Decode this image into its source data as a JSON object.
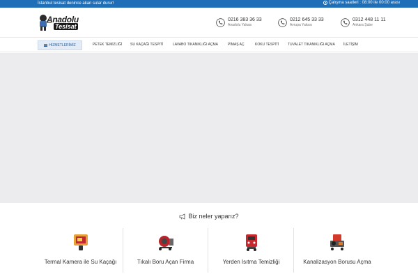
{
  "topbar": {
    "tagline": "İstanbul tesisat denince akan sular durur!",
    "hours": "Çalışma saatleri : 08:00 ile 00:00 arası"
  },
  "logo": {
    "brand_top": "Anadolu",
    "brand_bottom": "Tesisat"
  },
  "phones": [
    {
      "number": "0216 383 36 33",
      "label": "Anadolu Yakası"
    },
    {
      "number": "0212 645 33 33",
      "label": "Avrupa Yakası"
    },
    {
      "number": "0312 448 11 11",
      "label": "Ankara Şube"
    }
  ],
  "nav": {
    "menu_label": "HİZMETLERİMİZ",
    "items": [
      "PETEK TEMİZLİĞİ",
      "SU KAÇAĞI TESPİTİ",
      "LAVABO TIKANIKLIĞI AÇMA",
      "PİMAŞ AÇ",
      "KOKU TESPİTİ",
      "TUVALET TIKANIKLIĞI AÇMA",
      "İLETİŞİM"
    ]
  },
  "services": {
    "title": "Biz neler yaparız?",
    "cards": [
      {
        "label": "Termal Kamera ile Su Kaçağı",
        "icon": "thermal-camera-icon"
      },
      {
        "label": "Tıkalı Boru Açan Firma",
        "icon": "drain-machine-icon"
      },
      {
        "label": "Yerden Isıtma Temizliği",
        "icon": "heating-cleaner-icon"
      },
      {
        "label": "Kanalizasyon Borusu Açma",
        "icon": "sewer-machine-icon"
      }
    ]
  },
  "colors": {
    "topbar": "#1e6fb8",
    "hero_bg": "#ececee",
    "menu_button_bg": "#e3ecf6"
  }
}
